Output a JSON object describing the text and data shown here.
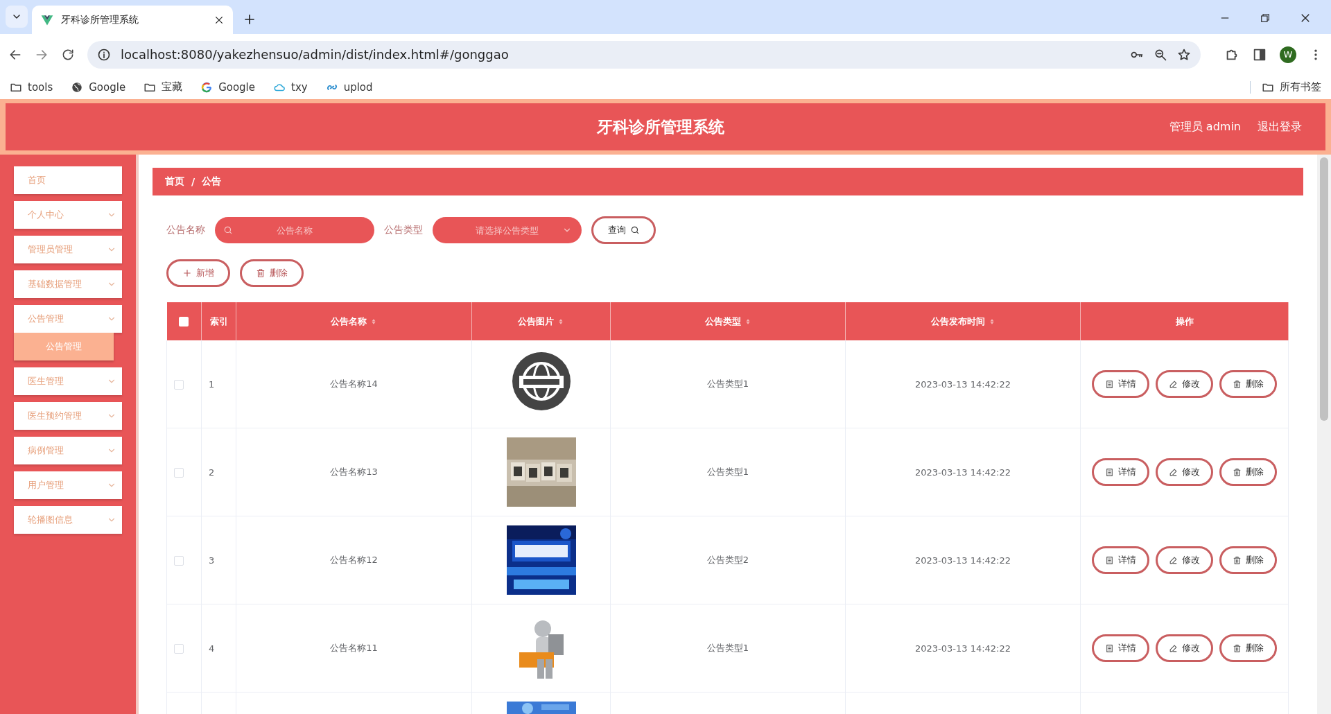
{
  "browser": {
    "tab_title": "牙科诊所管理系统",
    "url": "localhost:8080/yakezhensuo/admin/dist/index.html#/gonggao",
    "profile": "W",
    "all_bookmarks": "所有书签",
    "bookmarks": [
      {
        "label": "tools",
        "kind": "folder"
      },
      {
        "label": "Google",
        "kind": "globe"
      },
      {
        "label": "宝藏",
        "kind": "folder"
      },
      {
        "label": "Google",
        "kind": "google"
      },
      {
        "label": "txy",
        "kind": "cloud"
      },
      {
        "label": "uplod",
        "kind": "link"
      }
    ]
  },
  "header": {
    "title": "牙科诊所管理系统",
    "user": "管理员 admin",
    "logout": "退出登录"
  },
  "sidebar": {
    "items": [
      {
        "label": "首页",
        "expandable": false
      },
      {
        "label": "个人中心",
        "expandable": true,
        "expanded": false
      },
      {
        "label": "管理员管理",
        "expandable": true,
        "expanded": false
      },
      {
        "label": "基础数据管理",
        "expandable": true,
        "expanded": false
      },
      {
        "label": "公告管理",
        "expandable": true,
        "expanded": true,
        "children": [
          {
            "label": "公告管理",
            "selected": true
          }
        ]
      },
      {
        "label": "医生管理",
        "expandable": true,
        "expanded": false
      },
      {
        "label": "医生预约管理",
        "expandable": true,
        "expanded": false
      },
      {
        "label": "病例管理",
        "expandable": true,
        "expanded": false
      },
      {
        "label": "用户管理",
        "expandable": true,
        "expanded": false
      },
      {
        "label": "轮播图信息",
        "expandable": true,
        "expanded": false
      }
    ]
  },
  "breadcrumb": {
    "items": [
      "首页",
      "公告"
    ],
    "separator": "/"
  },
  "search": {
    "fields": [
      {
        "label": "公告名称",
        "placeholder": "公告名称",
        "kind": "text"
      },
      {
        "label": "公告类型",
        "placeholder": "请选择公告类型",
        "kind": "select"
      }
    ],
    "query_button": "查询"
  },
  "actions": [
    {
      "label": "新增",
      "kind": "add"
    },
    {
      "label": "删除",
      "kind": "delete"
    }
  ],
  "table": {
    "columns": [
      {
        "kind": "checkbox",
        "checked": false
      },
      {
        "kind": "text",
        "label": "索引",
        "sortable": false
      },
      {
        "kind": "text",
        "label": "公告名称",
        "sortable": true
      },
      {
        "kind": "text",
        "label": "公告图片",
        "sortable": true
      },
      {
        "kind": "text",
        "label": "公告类型",
        "sortable": true
      },
      {
        "kind": "text",
        "label": "公告发布时间",
        "sortable": true
      },
      {
        "kind": "text",
        "label": "操作",
        "sortable": false
      }
    ],
    "rows": [
      {
        "checked": false,
        "index": "1",
        "name": "公告名称14",
        "image": {
          "kind": "picture"
        },
        "type": "公告类型1",
        "time": "2023-03-13 14:42:22",
        "actions": [
          {
            "label": "详情",
            "kind": "detail"
          },
          {
            "label": "修改",
            "kind": "edit"
          },
          {
            "label": "删除",
            "kind": "delete"
          }
        ]
      },
      {
        "checked": false,
        "index": "2",
        "name": "公告名称13",
        "image": {
          "kind": "picture"
        },
        "type": "公告类型1",
        "time": "2023-03-13 14:42:22",
        "actions": [
          {
            "label": "详情",
            "kind": "detail"
          },
          {
            "label": "修改",
            "kind": "edit"
          },
          {
            "label": "删除",
            "kind": "delete"
          }
        ]
      },
      {
        "checked": false,
        "index": "3",
        "name": "公告名称12",
        "image": {
          "kind": "picture"
        },
        "type": "公告类型2",
        "time": "2023-03-13 14:42:22",
        "actions": [
          {
            "label": "详情",
            "kind": "detail"
          },
          {
            "label": "修改",
            "kind": "edit"
          },
          {
            "label": "删除",
            "kind": "delete"
          }
        ]
      },
      {
        "checked": false,
        "index": "4",
        "name": "公告名称11",
        "image": {
          "kind": "picture"
        },
        "type": "公告类型1",
        "time": "2023-03-13 14:42:22",
        "actions": [
          {
            "label": "详情",
            "kind": "detail"
          },
          {
            "label": "修改",
            "kind": "edit"
          },
          {
            "label": "删除",
            "kind": "delete"
          }
        ]
      },
      {
        "image": {
          "kind": "picture"
        }
      }
    ]
  }
}
